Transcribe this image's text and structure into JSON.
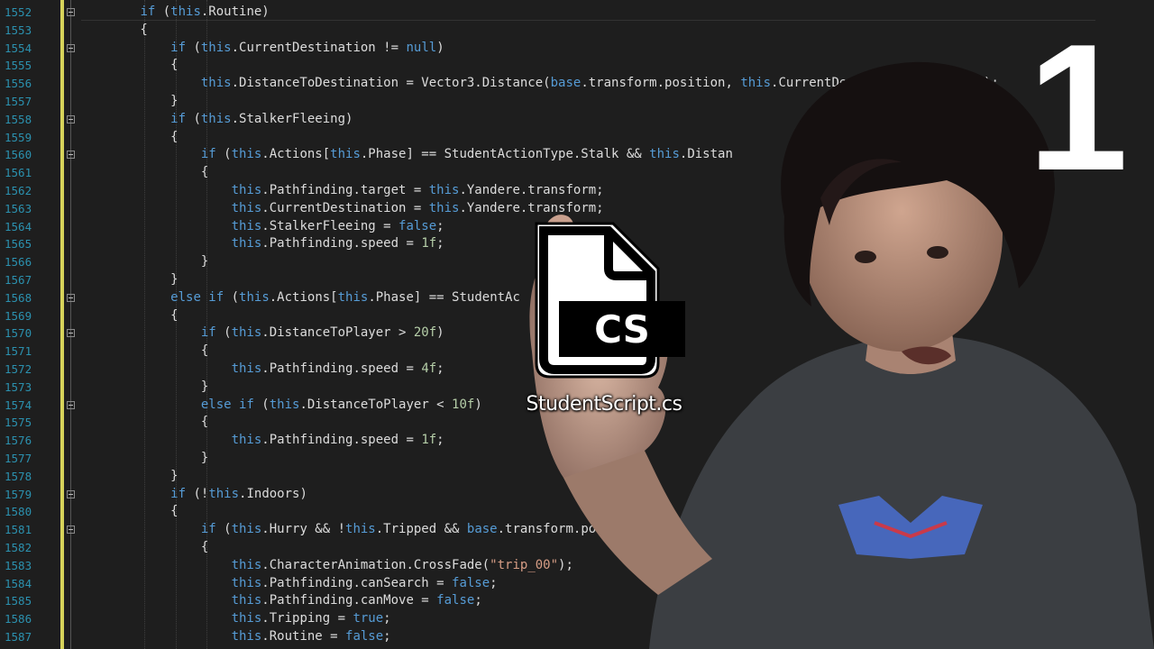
{
  "editor": {
    "lines": [
      {
        "n": "1552",
        "fold": true,
        "html": "        <span class=\"kw\">if</span> (<span class=\"kw\">this</span>.Routine)"
      },
      {
        "n": "1553",
        "fold": false,
        "html": "        {"
      },
      {
        "n": "1554",
        "fold": true,
        "html": "            <span class=\"kw\">if</span> (<span class=\"kw\">this</span>.CurrentDestination != <span class=\"kw\">null</span>)"
      },
      {
        "n": "1555",
        "fold": false,
        "html": "            {"
      },
      {
        "n": "1556",
        "fold": false,
        "html": "                <span class=\"kw\">this</span>.DistanceToDestination = Vector3.Distance(<span class=\"kw\">base</span>.transform.position, <span class=\"kw\">this</span>.CurrentDestination.position);"
      },
      {
        "n": "1557",
        "fold": false,
        "html": "            }"
      },
      {
        "n": "1558",
        "fold": true,
        "html": "            <span class=\"kw\">if</span> (<span class=\"kw\">this</span>.StalkerFleeing)"
      },
      {
        "n": "1559",
        "fold": false,
        "html": "            {"
      },
      {
        "n": "1560",
        "fold": true,
        "html": "                <span class=\"kw\">if</span> (<span class=\"kw\">this</span>.Actions[<span class=\"kw\">this</span>.Phase] == StudentActionType.Stalk &amp;&amp; <span class=\"kw\">this</span>.Distan"
      },
      {
        "n": "1561",
        "fold": false,
        "html": "                {"
      },
      {
        "n": "1562",
        "fold": false,
        "html": "                    <span class=\"kw\">this</span>.Pathfinding.target = <span class=\"kw\">this</span>.Yandere.transform;"
      },
      {
        "n": "1563",
        "fold": false,
        "html": "                    <span class=\"kw\">this</span>.CurrentDestination = <span class=\"kw\">this</span>.Yandere.transform;"
      },
      {
        "n": "1564",
        "fold": false,
        "html": "                    <span class=\"kw\">this</span>.StalkerFleeing = <span class=\"kw\">false</span>;"
      },
      {
        "n": "1565",
        "fold": false,
        "html": "                    <span class=\"kw\">this</span>.Pathfinding.speed = <span class=\"num\">1f</span>;"
      },
      {
        "n": "1566",
        "fold": false,
        "html": "                }"
      },
      {
        "n": "1567",
        "fold": false,
        "html": "            }"
      },
      {
        "n": "1568",
        "fold": true,
        "html": "            <span class=\"kw\">else if</span> (<span class=\"kw\">this</span>.Actions[<span class=\"kw\">this</span>.Phase] == StudentAc"
      },
      {
        "n": "1569",
        "fold": false,
        "html": "            {"
      },
      {
        "n": "1570",
        "fold": true,
        "html": "                <span class=\"kw\">if</span> (<span class=\"kw\">this</span>.DistanceToPlayer &gt; <span class=\"num\">20f</span>)"
      },
      {
        "n": "1571",
        "fold": false,
        "html": "                {"
      },
      {
        "n": "1572",
        "fold": false,
        "html": "                    <span class=\"kw\">this</span>.Pathfinding.speed = <span class=\"num\">4f</span>;"
      },
      {
        "n": "1573",
        "fold": false,
        "html": "                }"
      },
      {
        "n": "1574",
        "fold": true,
        "html": "                <span class=\"kw\">else if</span> (<span class=\"kw\">this</span>.DistanceToPlayer &lt; <span class=\"num\">10f</span>)"
      },
      {
        "n": "1575",
        "fold": false,
        "html": "                {"
      },
      {
        "n": "1576",
        "fold": false,
        "html": "                    <span class=\"kw\">this</span>.Pathfinding.speed = <span class=\"num\">1f</span>;"
      },
      {
        "n": "1577",
        "fold": false,
        "html": "                }"
      },
      {
        "n": "1578",
        "fold": false,
        "html": "            }"
      },
      {
        "n": "1579",
        "fold": true,
        "html": "            <span class=\"kw\">if</span> (!<span class=\"kw\">this</span>.Indoors)"
      },
      {
        "n": "1580",
        "fold": false,
        "html": "            {"
      },
      {
        "n": "1581",
        "fold": true,
        "html": "                <span class=\"kw\">if</span> (<span class=\"kw\">this</span>.Hurry &amp;&amp; !<span class=\"kw\">this</span>.Tripped &amp;&amp; <span class=\"kw\">base</span>.transform.po"
      },
      {
        "n": "1582",
        "fold": false,
        "html": "                {"
      },
      {
        "n": "1583",
        "fold": false,
        "html": "                    <span class=\"kw\">this</span>.CharacterAnimation.CrossFade(<span class=\"str\">\"trip_00\"</span>);"
      },
      {
        "n": "1584",
        "fold": false,
        "html": "                    <span class=\"kw\">this</span>.Pathfinding.canSearch = <span class=\"kw\">false</span>;"
      },
      {
        "n": "1585",
        "fold": false,
        "html": "                    <span class=\"kw\">this</span>.Pathfinding.canMove = <span class=\"kw\">false</span>;"
      },
      {
        "n": "1586",
        "fold": false,
        "html": "                    <span class=\"kw\">this</span>.Tripping = <span class=\"kw\">true</span>;"
      },
      {
        "n": "1587",
        "fold": false,
        "html": "                    <span class=\"kw\">this</span>.Routine = <span class=\"kw\">false</span>;"
      }
    ]
  },
  "overlay": {
    "file_icon_text": "CS",
    "file_name": "StudentScript.cs",
    "episode_number": "1",
    "icons": [
      "cs-file-icon"
    ]
  },
  "colors": {
    "background": "#1e1e1e",
    "keyword": "#569cd6",
    "line_number": "#2b91af",
    "string": "#d69d85",
    "number": "#b5cea8",
    "change_bar": "#d7d35a"
  }
}
